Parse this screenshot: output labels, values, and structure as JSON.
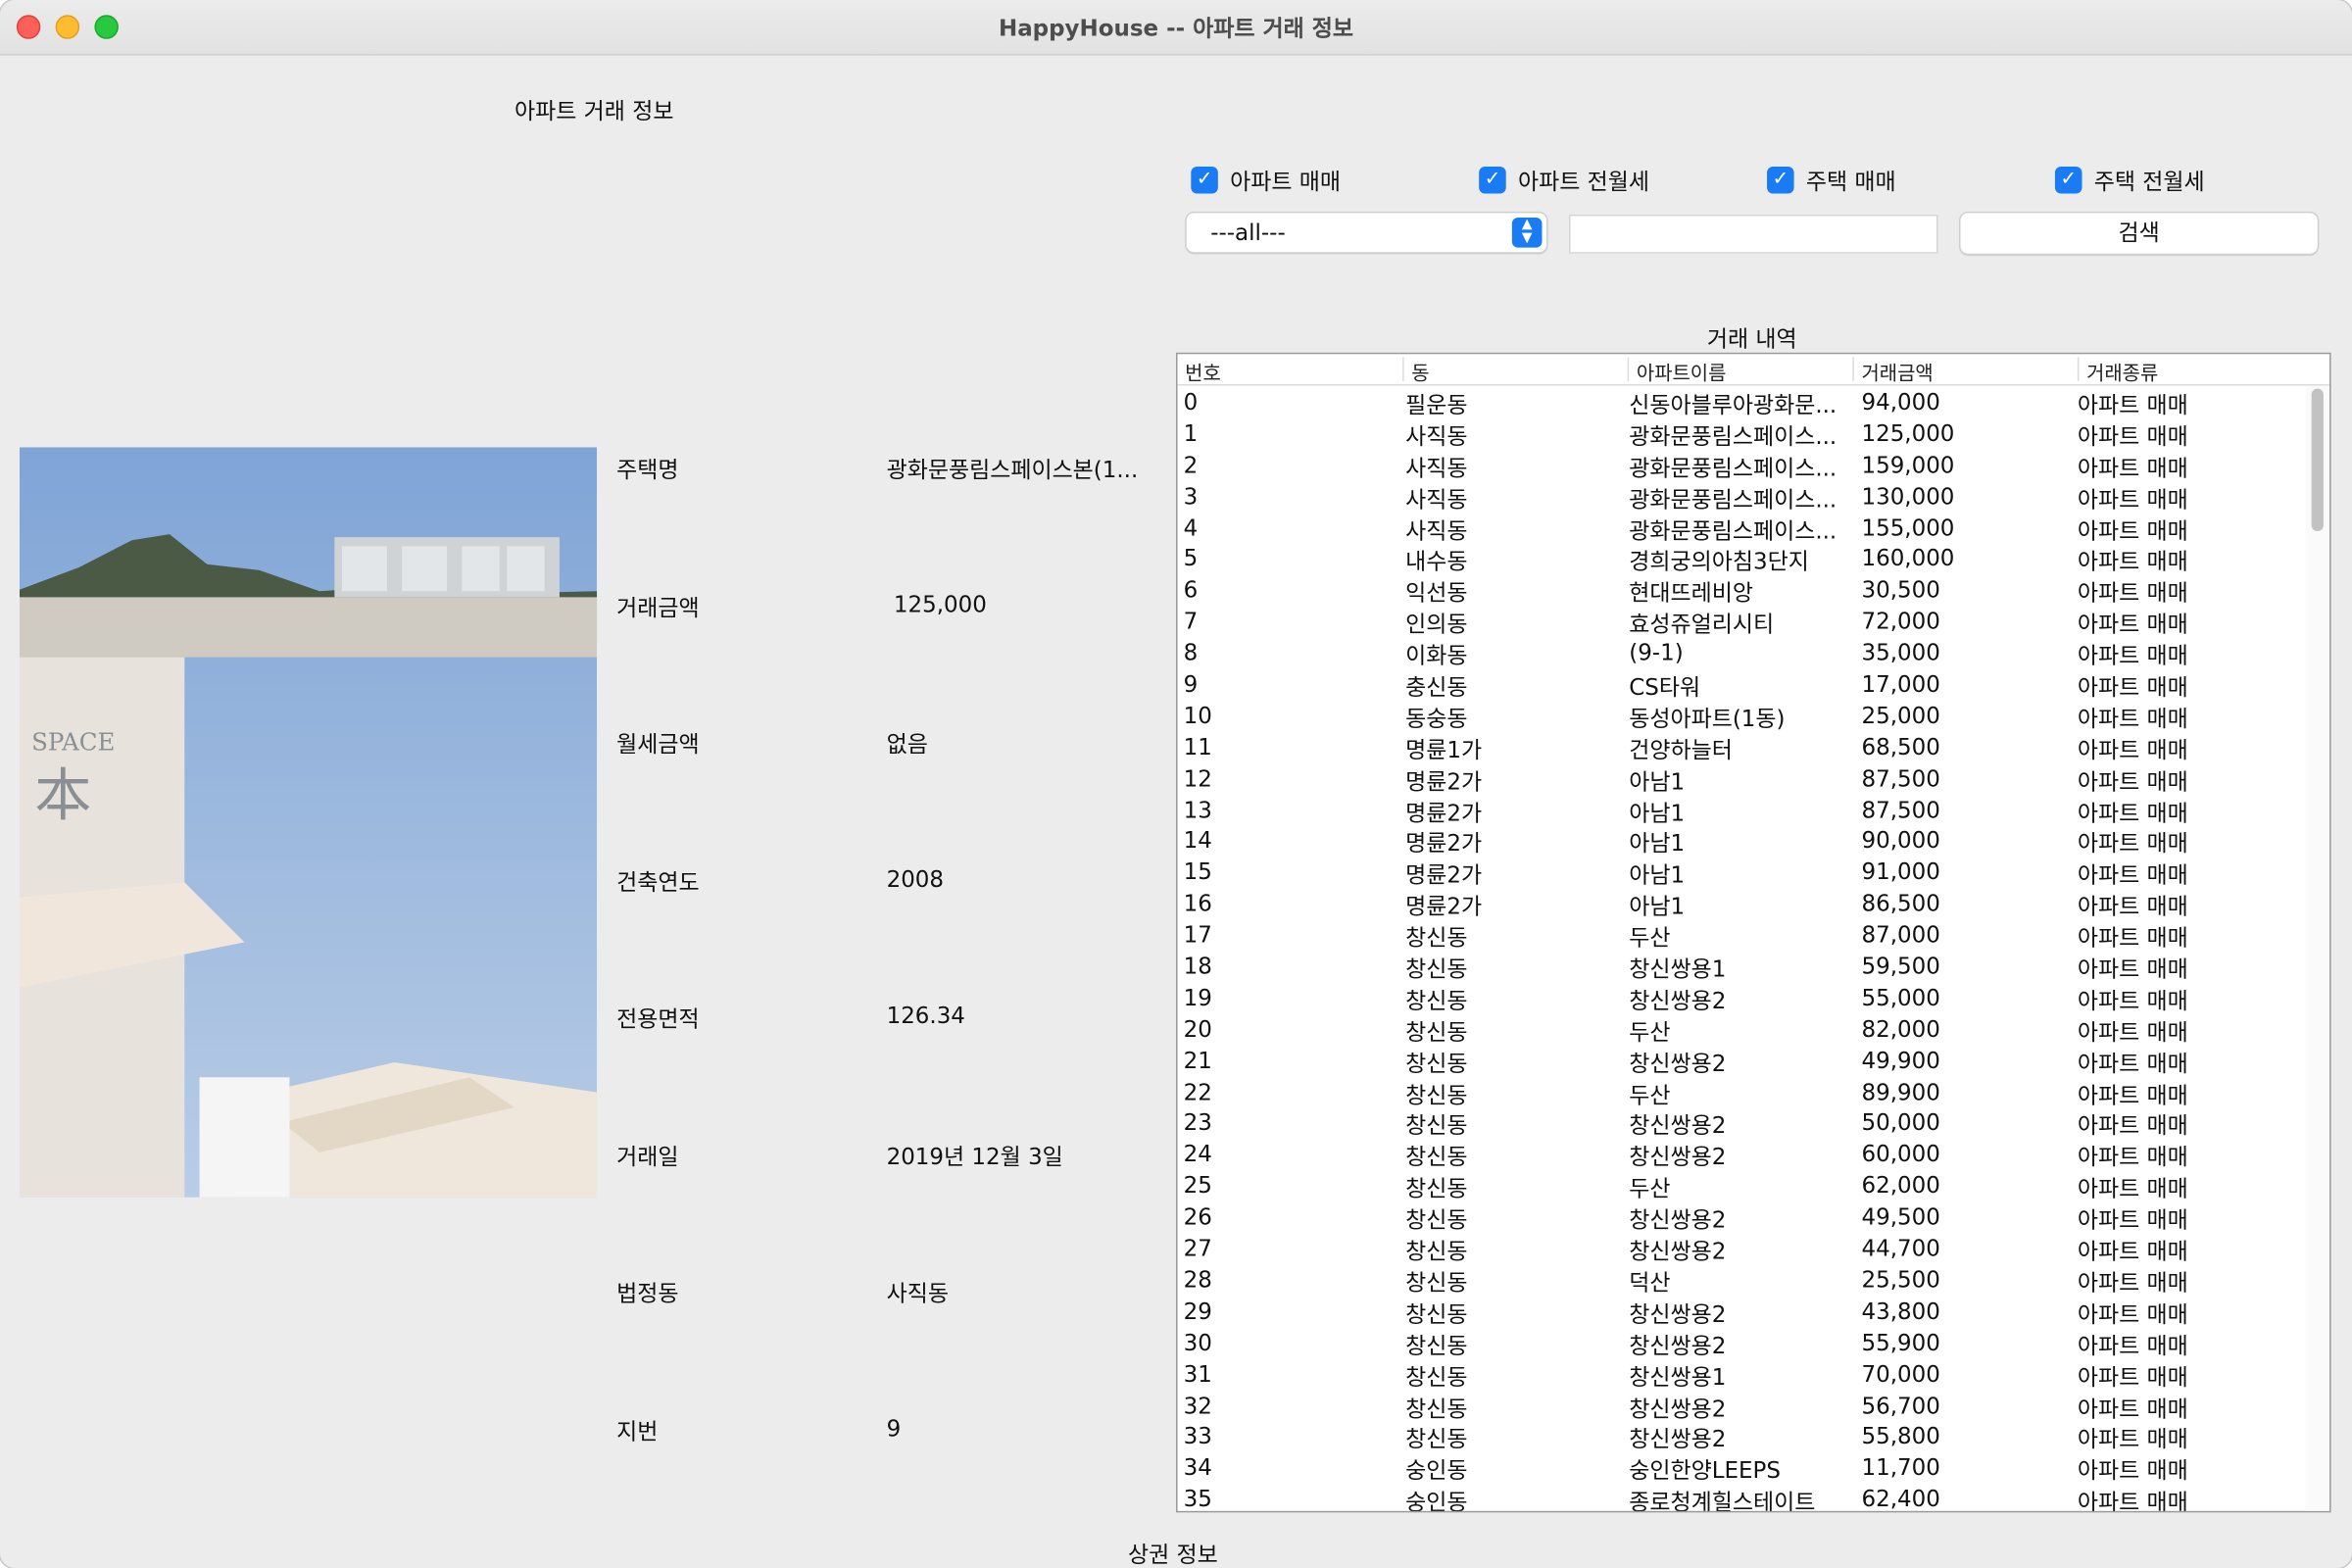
{
  "window": {
    "title": "HappyHouse -- 아파트 거래 정보"
  },
  "panel_title": "아파트 거래 정보",
  "filters": {
    "checkboxes": [
      {
        "label": "아파트 매매",
        "checked": true
      },
      {
        "label": "아파트 전월세",
        "checked": true
      },
      {
        "label": "주택 매매",
        "checked": true
      },
      {
        "label": "주택 전월세",
        "checked": true
      }
    ],
    "select_value": "---all---",
    "search_text": "",
    "search_button": "검색"
  },
  "detail": {
    "rows": [
      {
        "label": "주택명",
        "value": "광화문풍림스페이스본(1..."
      },
      {
        "label": "거래금액",
        "value": " 125,000"
      },
      {
        "label": "월세금액",
        "value": "없음"
      },
      {
        "label": "건축연도",
        "value": "2008"
      },
      {
        "label": "전용면적",
        "value": "126.34"
      },
      {
        "label": "거래일",
        "value": "2019년 12월 3일"
      },
      {
        "label": "법정동",
        "value": "사직동"
      },
      {
        "label": "지번",
        "value": "9"
      }
    ],
    "photo_sign": "SPACE",
    "photo_sign_char": "本"
  },
  "table": {
    "title": "거래 내역",
    "columns": [
      "번호",
      "동",
      "아파트이름",
      "거래금액",
      "거래종류"
    ],
    "rows": [
      [
        "0",
        "필운동",
        "신동아블루아광화문...",
        "94,000",
        "아파트 매매"
      ],
      [
        "1",
        "사직동",
        "광화문풍림스페이스...",
        "125,000",
        "아파트 매매"
      ],
      [
        "2",
        "사직동",
        "광화문풍림스페이스...",
        "159,000",
        "아파트 매매"
      ],
      [
        "3",
        "사직동",
        "광화문풍림스페이스...",
        "130,000",
        "아파트 매매"
      ],
      [
        "4",
        "사직동",
        "광화문풍림스페이스...",
        "155,000",
        "아파트 매매"
      ],
      [
        "5",
        "내수동",
        "경희궁의아침3단지",
        "160,000",
        "아파트 매매"
      ],
      [
        "6",
        "익선동",
        "현대뜨레비앙",
        "30,500",
        "아파트 매매"
      ],
      [
        "7",
        "인의동",
        "효성쥬얼리시티",
        "72,000",
        "아파트 매매"
      ],
      [
        "8",
        "이화동",
        "(9-1)",
        "35,000",
        "아파트 매매"
      ],
      [
        "9",
        "충신동",
        "CS타워",
        "17,000",
        "아파트 매매"
      ],
      [
        "10",
        "동숭동",
        "동성아파트(1동)",
        "25,000",
        "아파트 매매"
      ],
      [
        "11",
        "명륜1가",
        "건양하늘터",
        "68,500",
        "아파트 매매"
      ],
      [
        "12",
        "명륜2가",
        "아남1",
        "87,500",
        "아파트 매매"
      ],
      [
        "13",
        "명륜2가",
        "아남1",
        "87,500",
        "아파트 매매"
      ],
      [
        "14",
        "명륜2가",
        "아남1",
        "90,000",
        "아파트 매매"
      ],
      [
        "15",
        "명륜2가",
        "아남1",
        "91,000",
        "아파트 매매"
      ],
      [
        "16",
        "명륜2가",
        "아남1",
        "86,500",
        "아파트 매매"
      ],
      [
        "17",
        "창신동",
        "두산",
        "87,000",
        "아파트 매매"
      ],
      [
        "18",
        "창신동",
        "창신쌍용1",
        "59,500",
        "아파트 매매"
      ],
      [
        "19",
        "창신동",
        "창신쌍용2",
        "55,000",
        "아파트 매매"
      ],
      [
        "20",
        "창신동",
        "두산",
        "82,000",
        "아파트 매매"
      ],
      [
        "21",
        "창신동",
        "창신쌍용2",
        "49,900",
        "아파트 매매"
      ],
      [
        "22",
        "창신동",
        "두산",
        "89,900",
        "아파트 매매"
      ],
      [
        "23",
        "창신동",
        "창신쌍용2",
        "50,000",
        "아파트 매매"
      ],
      [
        "24",
        "창신동",
        "창신쌍용2",
        "60,000",
        "아파트 매매"
      ],
      [
        "25",
        "창신동",
        "두산",
        "62,000",
        "아파트 매매"
      ],
      [
        "26",
        "창신동",
        "창신쌍용2",
        "49,500",
        "아파트 매매"
      ],
      [
        "27",
        "창신동",
        "창신쌍용2",
        "44,700",
        "아파트 매매"
      ],
      [
        "28",
        "창신동",
        "덕산",
        "25,500",
        "아파트 매매"
      ],
      [
        "29",
        "창신동",
        "창신쌍용2",
        "43,800",
        "아파트 매매"
      ],
      [
        "30",
        "창신동",
        "창신쌍용2",
        "55,900",
        "아파트 매매"
      ],
      [
        "31",
        "창신동",
        "창신쌍용1",
        "70,000",
        "아파트 매매"
      ],
      [
        "32",
        "창신동",
        "창신쌍용2",
        "56,700",
        "아파트 매매"
      ],
      [
        "33",
        "창신동",
        "창신쌍용2",
        "55,800",
        "아파트 매매"
      ],
      [
        "34",
        "숭인동",
        "숭인한양LEEPS",
        "11,700",
        "아파트 매매"
      ],
      [
        "35",
        "숭인동",
        "종로청계힐스테이트",
        "62,400",
        "아파트 매매"
      ]
    ]
  },
  "footer_title": "상권 정보",
  "colors": {
    "accent": "#1a7cf5",
    "window_bg": "#ececec"
  }
}
